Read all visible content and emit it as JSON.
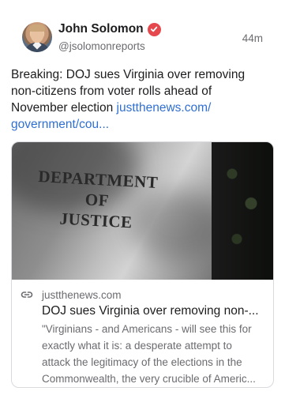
{
  "author": {
    "display_name": "John Solomon",
    "handle": "@jsolomonreports",
    "verified_icon": "verified-check-icon",
    "verified_color": "#e5484d"
  },
  "post": {
    "time_ago": "44m",
    "text": "Breaking: DOJ sues Virginia over removing non-citizens from voter rolls ahead of November election ",
    "link_line1": "justthenews.com/",
    "link_line2": "government/cou...",
    "link_color": "#2f6fd1"
  },
  "card": {
    "image_sign_lines": [
      "DEPARTMENT",
      "OF",
      "JUSTICE"
    ],
    "source": "justthenews.com",
    "source_icon": "link-icon",
    "title": "DOJ sues Virginia over removing non-...",
    "description_lines": [
      "\"Virginians - and Americans - will see this for",
      "exactly what it is: a desperate attempt to",
      "attack the legitimacy of the elections in the",
      "Commonwealth, the very crucible of Americ..."
    ]
  }
}
